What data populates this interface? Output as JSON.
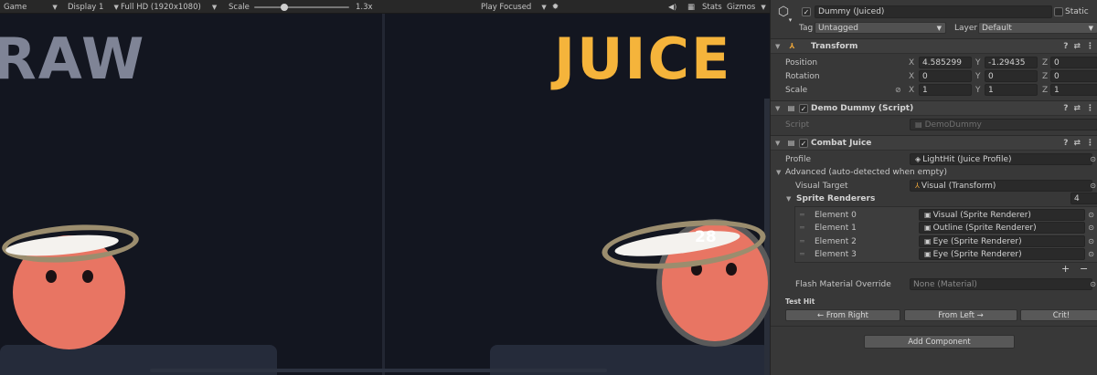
{
  "game_toolbar": {
    "mode": "Game",
    "display": "Display 1",
    "resolution": "Full HD (1920x1080)",
    "scale_label": "Scale",
    "scale_value": "1.3x",
    "play_mode": "Play Focused",
    "stats": "Stats",
    "gizmos": "Gizmos"
  },
  "scene": {
    "left_label": "RAW",
    "right_label": "JUICE",
    "damage_number": "28",
    "colors": {
      "raw": "#7f8496",
      "juice": "#f5b43b",
      "dummy": "#e87563"
    }
  },
  "inspector": {
    "object_name": "Dummy (Juiced)",
    "static_label": "Static",
    "tag_label": "Tag",
    "tag_value": "Untagged",
    "layer_label": "Layer",
    "layer_value": "Default",
    "transform": {
      "title": "Transform",
      "position_label": "Position",
      "rotation_label": "Rotation",
      "scale_label": "Scale",
      "position": {
        "x": "4.585299",
        "y": "-1.29435",
        "z": "0"
      },
      "rotation": {
        "x": "0",
        "y": "0",
        "z": "0"
      },
      "scale": {
        "x": "1",
        "y": "1",
        "z": "1"
      },
      "axis_x": "X",
      "axis_y": "Y",
      "axis_z": "Z"
    },
    "demo_dummy": {
      "title": "Demo Dummy (Script)",
      "script_label": "Script",
      "script_value": "DemoDummy"
    },
    "combat_juice": {
      "title": "Combat Juice",
      "profile_label": "Profile",
      "profile_value": "LightHit (Juice Profile)",
      "advanced_label": "Advanced (auto-detected when empty)",
      "visual_target_label": "Visual Target",
      "visual_target_value": "Visual (Transform)",
      "sprite_renderers_label": "Sprite Renderers",
      "sprite_renderers_count": "4",
      "elements": [
        {
          "label": "Element 0",
          "value": "Visual (Sprite Renderer)"
        },
        {
          "label": "Element 1",
          "value": "Outline (Sprite Renderer)"
        },
        {
          "label": "Element 2",
          "value": "Eye (Sprite Renderer)"
        },
        {
          "label": "Element 3",
          "value": "Eye (Sprite Renderer)"
        }
      ],
      "add_symbol": "+",
      "remove_symbol": "−",
      "flash_label": "Flash Material Override",
      "flash_value": "None (Material)",
      "test_hit_label": "Test Hit",
      "from_right": "← From Right",
      "from_left": "From Left →",
      "crit": "Crit!"
    },
    "add_component": "Add Component"
  }
}
